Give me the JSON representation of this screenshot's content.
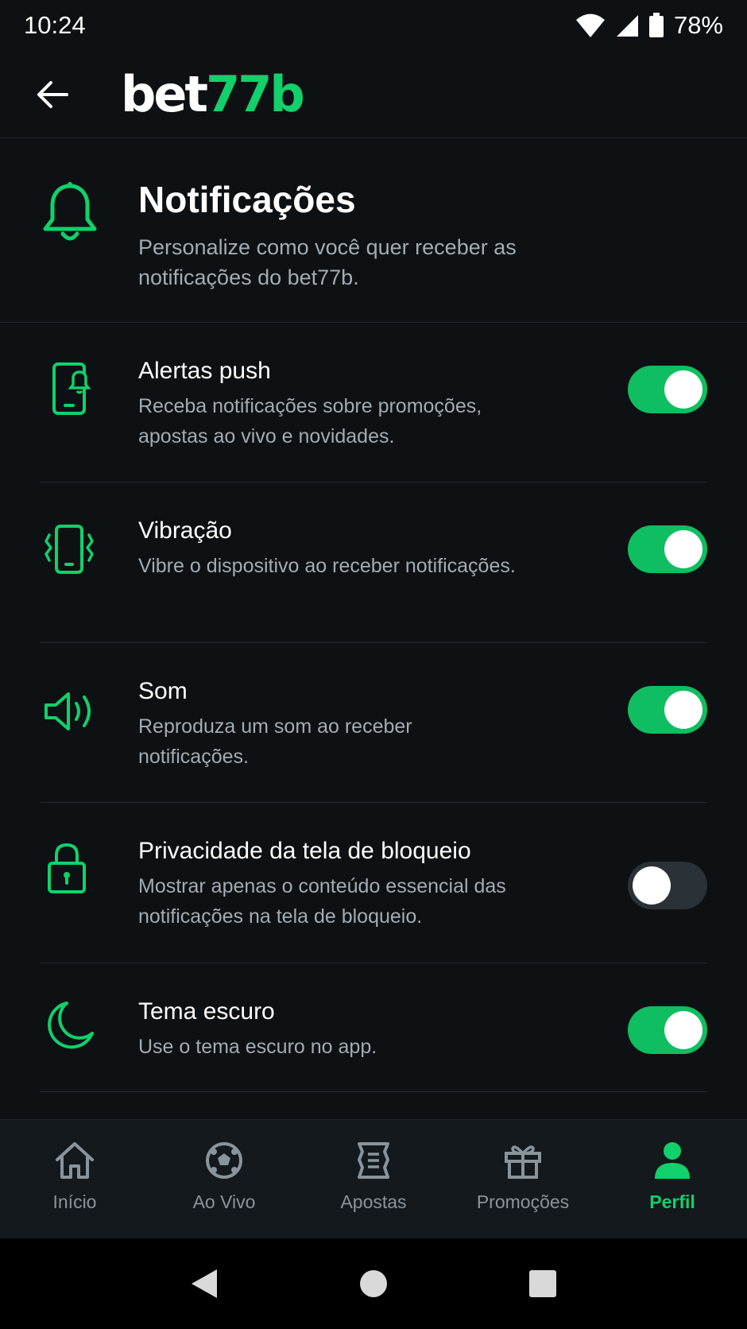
{
  "status_bar": {
    "time": "10:24",
    "battery": "78%"
  },
  "header": {
    "logo_part1": "bet",
    "logo_part2": "77b"
  },
  "intro": {
    "title": "Notificações",
    "description": "Personalize como você quer receber as notificações do bet77b."
  },
  "settings": [
    {
      "label": "Alertas push",
      "description": "Receba notificações sobre promoções, apostas ao vivo e novidades.",
      "enabled": true,
      "icon": "phone-bell-icon"
    },
    {
      "label": "Vibração",
      "description": "Vibre o dispositivo ao receber notificações.",
      "enabled": true,
      "icon": "vibrate-icon"
    },
    {
      "label": "Som",
      "description": "Reproduza um som ao receber notificações.",
      "enabled": true,
      "icon": "speaker-icon"
    },
    {
      "label": "Privacidade da tela de bloqueio",
      "description": "Mostrar apenas o conteúdo essencial das notificações na tela de bloqueio.",
      "enabled": false,
      "icon": "lock-icon"
    },
    {
      "label": "Tema escuro",
      "description": "Use o tema escuro no app.",
      "enabled": true,
      "icon": "moon-icon"
    }
  ],
  "bottom_nav": [
    {
      "label": "Início",
      "icon": "home-icon",
      "active": false
    },
    {
      "label": "Ao Vivo",
      "icon": "soccer-ball-icon",
      "active": false
    },
    {
      "label": "Apostas",
      "icon": "ticket-icon",
      "active": false
    },
    {
      "label": "Promoções",
      "icon": "gift-icon",
      "active": false
    },
    {
      "label": "Perfil",
      "icon": "user-icon",
      "active": true
    }
  ],
  "colors": {
    "accent": "#10d16b",
    "toggle_on": "#0fbe60",
    "background": "#0d1114"
  }
}
